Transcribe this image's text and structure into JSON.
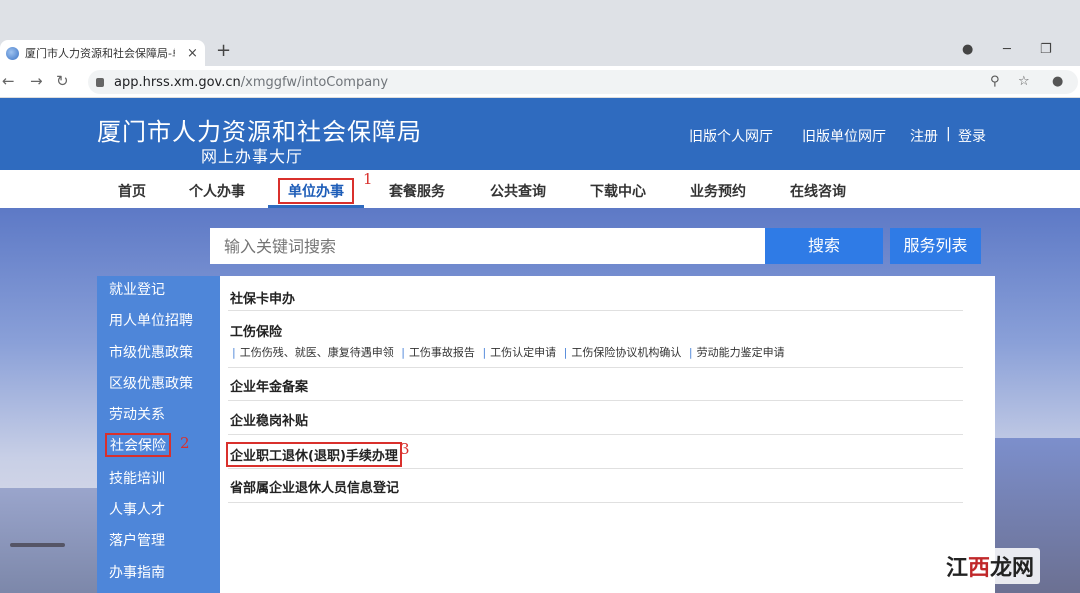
{
  "browser": {
    "tab_title": "厦门市人力资源和社会保障局-单",
    "tab_close": "×",
    "new_tab": "+",
    "url_host": "app.hrss.xm.gov.cn",
    "url_path": "/xmggfw/intoCompany",
    "icons": [
      "back-icon",
      "forward-icon",
      "reload-icon",
      "lock-icon",
      "zoom-icon",
      "star-icon",
      "profile-icon",
      "extension-icon",
      "minimize-icon",
      "restore-icon"
    ]
  },
  "header": {
    "title": "厦门市人力资源和社会保障局",
    "subtitle": "网上办事大厅",
    "links": [
      "旧版个人网厅",
      "旧版单位网厅",
      "注册",
      "|",
      "登录"
    ]
  },
  "nav": {
    "items": [
      "首页",
      "个人办事",
      "单位办事",
      "套餐服务",
      "公共查询",
      "下载中心",
      "业务预约",
      "在线咨询"
    ],
    "active": "单位办事"
  },
  "search": {
    "placeholder": "输入关键词搜索",
    "button": "搜索",
    "list_button": "服务列表"
  },
  "sidemenu": {
    "items": [
      "就业登记",
      "用人单位招聘",
      "市级优惠政策",
      "区级优惠政策",
      "劳动关系",
      "社会保险",
      "技能培训",
      "人事人才",
      "落户管理",
      "办事指南"
    ],
    "active": "社会保险"
  },
  "content": {
    "sections": [
      {
        "title": "社保卡申办"
      },
      {
        "title": "工伤保险",
        "links": [
          "工伤伤残、就医、康复待遇申领",
          "工伤事故报告",
          "工伤认定申请",
          "工伤保险协议机构确认",
          "劳动能力鉴定申请"
        ]
      },
      {
        "title": "企业年金备案"
      },
      {
        "title": "企业稳岗补贴"
      },
      {
        "title": "企业职工退休(退职)手续办理"
      },
      {
        "title": "省部属企业退休人员信息登记"
      }
    ]
  },
  "annotations": {
    "step1": "1",
    "step2": "2",
    "step3": "3"
  },
  "watermark": {
    "part1": "江",
    "part2": "西",
    "part3": "龙网"
  }
}
